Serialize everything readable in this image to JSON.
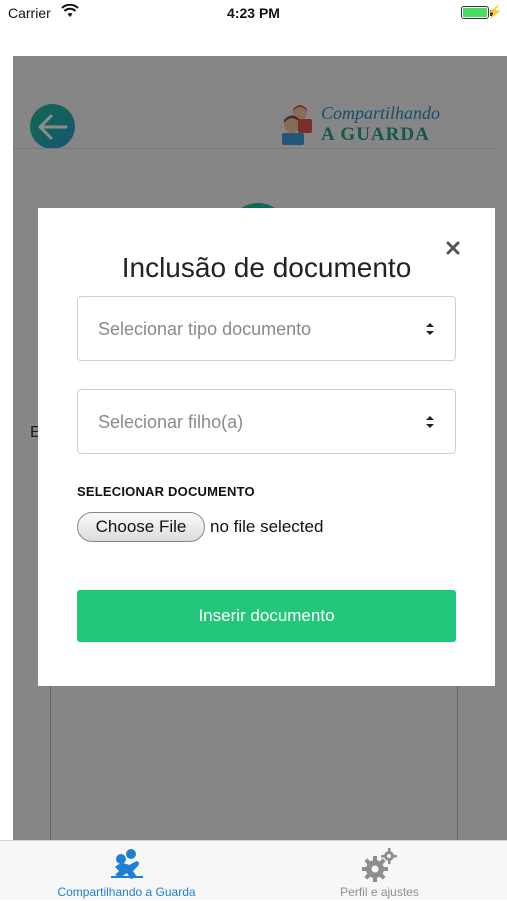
{
  "status_bar": {
    "carrier": "Carrier",
    "time": "4:23 PM",
    "battery_level": 1.0
  },
  "header": {
    "logo_line1": "Compartilhando",
    "logo_line2": "A GUARDA",
    "back_icon": "arrow-left-icon"
  },
  "background": {
    "partial_letter": "E"
  },
  "modal": {
    "title": "Inclusão de documento",
    "close_icon": "close-icon",
    "document_type_select": {
      "placeholder": "Selecionar tipo documento"
    },
    "child_select": {
      "placeholder": "Selecionar filho(a)"
    },
    "section_label": "SELECIONAR DOCUMENTO",
    "choose_file_label": "Choose File",
    "file_status": "no file selected",
    "submit_label": "Inserir documento"
  },
  "tab_bar": {
    "tabs": [
      {
        "label": "Compartilhando a Guarda",
        "icon": "kids-icon",
        "active": true
      },
      {
        "label": "Perfil e ajustes",
        "icon": "gears-icon",
        "active": false
      }
    ]
  },
  "colors": {
    "primary_green": "#23c77a",
    "active_tab": "#1f7fd6",
    "logo_blue": "#2a8ec8",
    "logo_green": "#23a089"
  }
}
